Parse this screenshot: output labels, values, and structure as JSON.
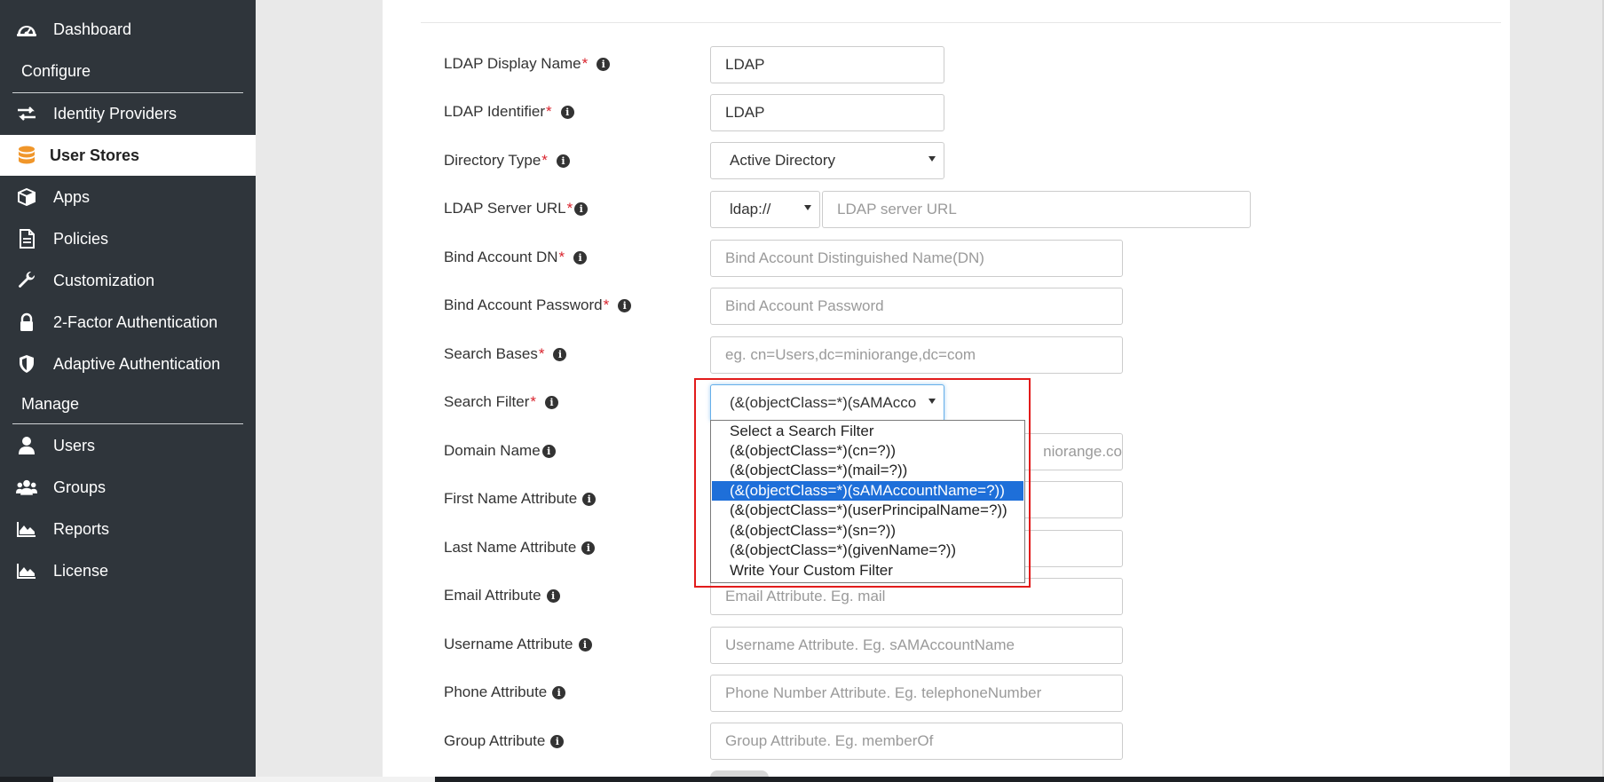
{
  "sidebar": {
    "items": [
      {
        "label": "Dashboard",
        "icon": "dashboard-icon"
      },
      {
        "label": "Identity Providers",
        "icon": "exchange-arrows-icon"
      },
      {
        "label": "User Stores",
        "icon": "database-icon",
        "active": true
      },
      {
        "label": "Apps",
        "icon": "cube-icon"
      },
      {
        "label": "Policies",
        "icon": "document-icon"
      },
      {
        "label": "Customization",
        "icon": "wrench-icon"
      },
      {
        "label": "2-Factor Authentication",
        "icon": "lock-icon"
      },
      {
        "label": "Adaptive Authentication",
        "icon": "shield-icon"
      },
      {
        "label": "Users",
        "icon": "user-icon"
      },
      {
        "label": "Groups",
        "icon": "group-icon"
      },
      {
        "label": "Reports",
        "icon": "area-chart-icon"
      },
      {
        "label": "License",
        "icon": "area-chart-icon"
      }
    ],
    "sections": {
      "configure": "Configure",
      "manage": "Manage"
    }
  },
  "form": {
    "display_name": {
      "label": "LDAP Display Name",
      "required": "*",
      "value": "LDAP"
    },
    "identifier": {
      "label": "LDAP Identifier",
      "required": "*",
      "value": "LDAP"
    },
    "directory_type": {
      "label": "Directory Type",
      "required": "*",
      "value": "Active Directory"
    },
    "server_url": {
      "label": "LDAP Server URL",
      "required": "*",
      "protocol": "ldap://",
      "placeholder": "LDAP server URL"
    },
    "bind_dn": {
      "label": "Bind Account DN",
      "required": "*",
      "placeholder": "Bind Account Distinguished Name(DN)"
    },
    "bind_password": {
      "label": "Bind Account Password",
      "required": "*",
      "placeholder": "Bind Account Password"
    },
    "search_bases": {
      "label": "Search Bases",
      "required": "*",
      "placeholder": "eg. cn=Users,dc=miniorange,dc=com"
    },
    "search_filter": {
      "label": "Search Filter",
      "required": "*",
      "value": "(&(objectClass=*)(sAMAccountName=?))"
    },
    "domain_name": {
      "label": "Domain Name",
      "placeholder_visible": "niorange.co"
    },
    "first_name": {
      "label": "First Name Attribute"
    },
    "last_name": {
      "label": "Last Name Attribute"
    },
    "email": {
      "label": "Email Attribute",
      "placeholder": "Email Attribute. Eg. mail"
    },
    "username": {
      "label": "Username Attribute",
      "placeholder": "Username Attribute. Eg. sAMAccountName"
    },
    "phone": {
      "label": "Phone Attribute",
      "placeholder": "Phone Number Attribute. Eg. telephoneNumber"
    },
    "group": {
      "label": "Group Attribute",
      "placeholder": "Group Attribute. Eg. memberOf"
    }
  },
  "search_filter_options": [
    "Select a Search Filter",
    "(&(objectClass=*)(cn=?))",
    "(&(objectClass=*)(mail=?))",
    "(&(objectClass=*)(sAMAccountName=?))",
    "(&(objectClass=*)(userPrincipalName=?))",
    "(&(objectClass=*)(sn=?))",
    "(&(objectClass=*)(givenName=?))",
    "Write Your Custom Filter"
  ],
  "selected_option_index": 3,
  "info_glyph": "i",
  "colors": {
    "sidebar_bg": "#2f353b",
    "accent_orange": "#f0962a",
    "required_red": "#d9232d",
    "highlight_red": "#e21b1b",
    "option_selected": "#1e6fd9"
  }
}
